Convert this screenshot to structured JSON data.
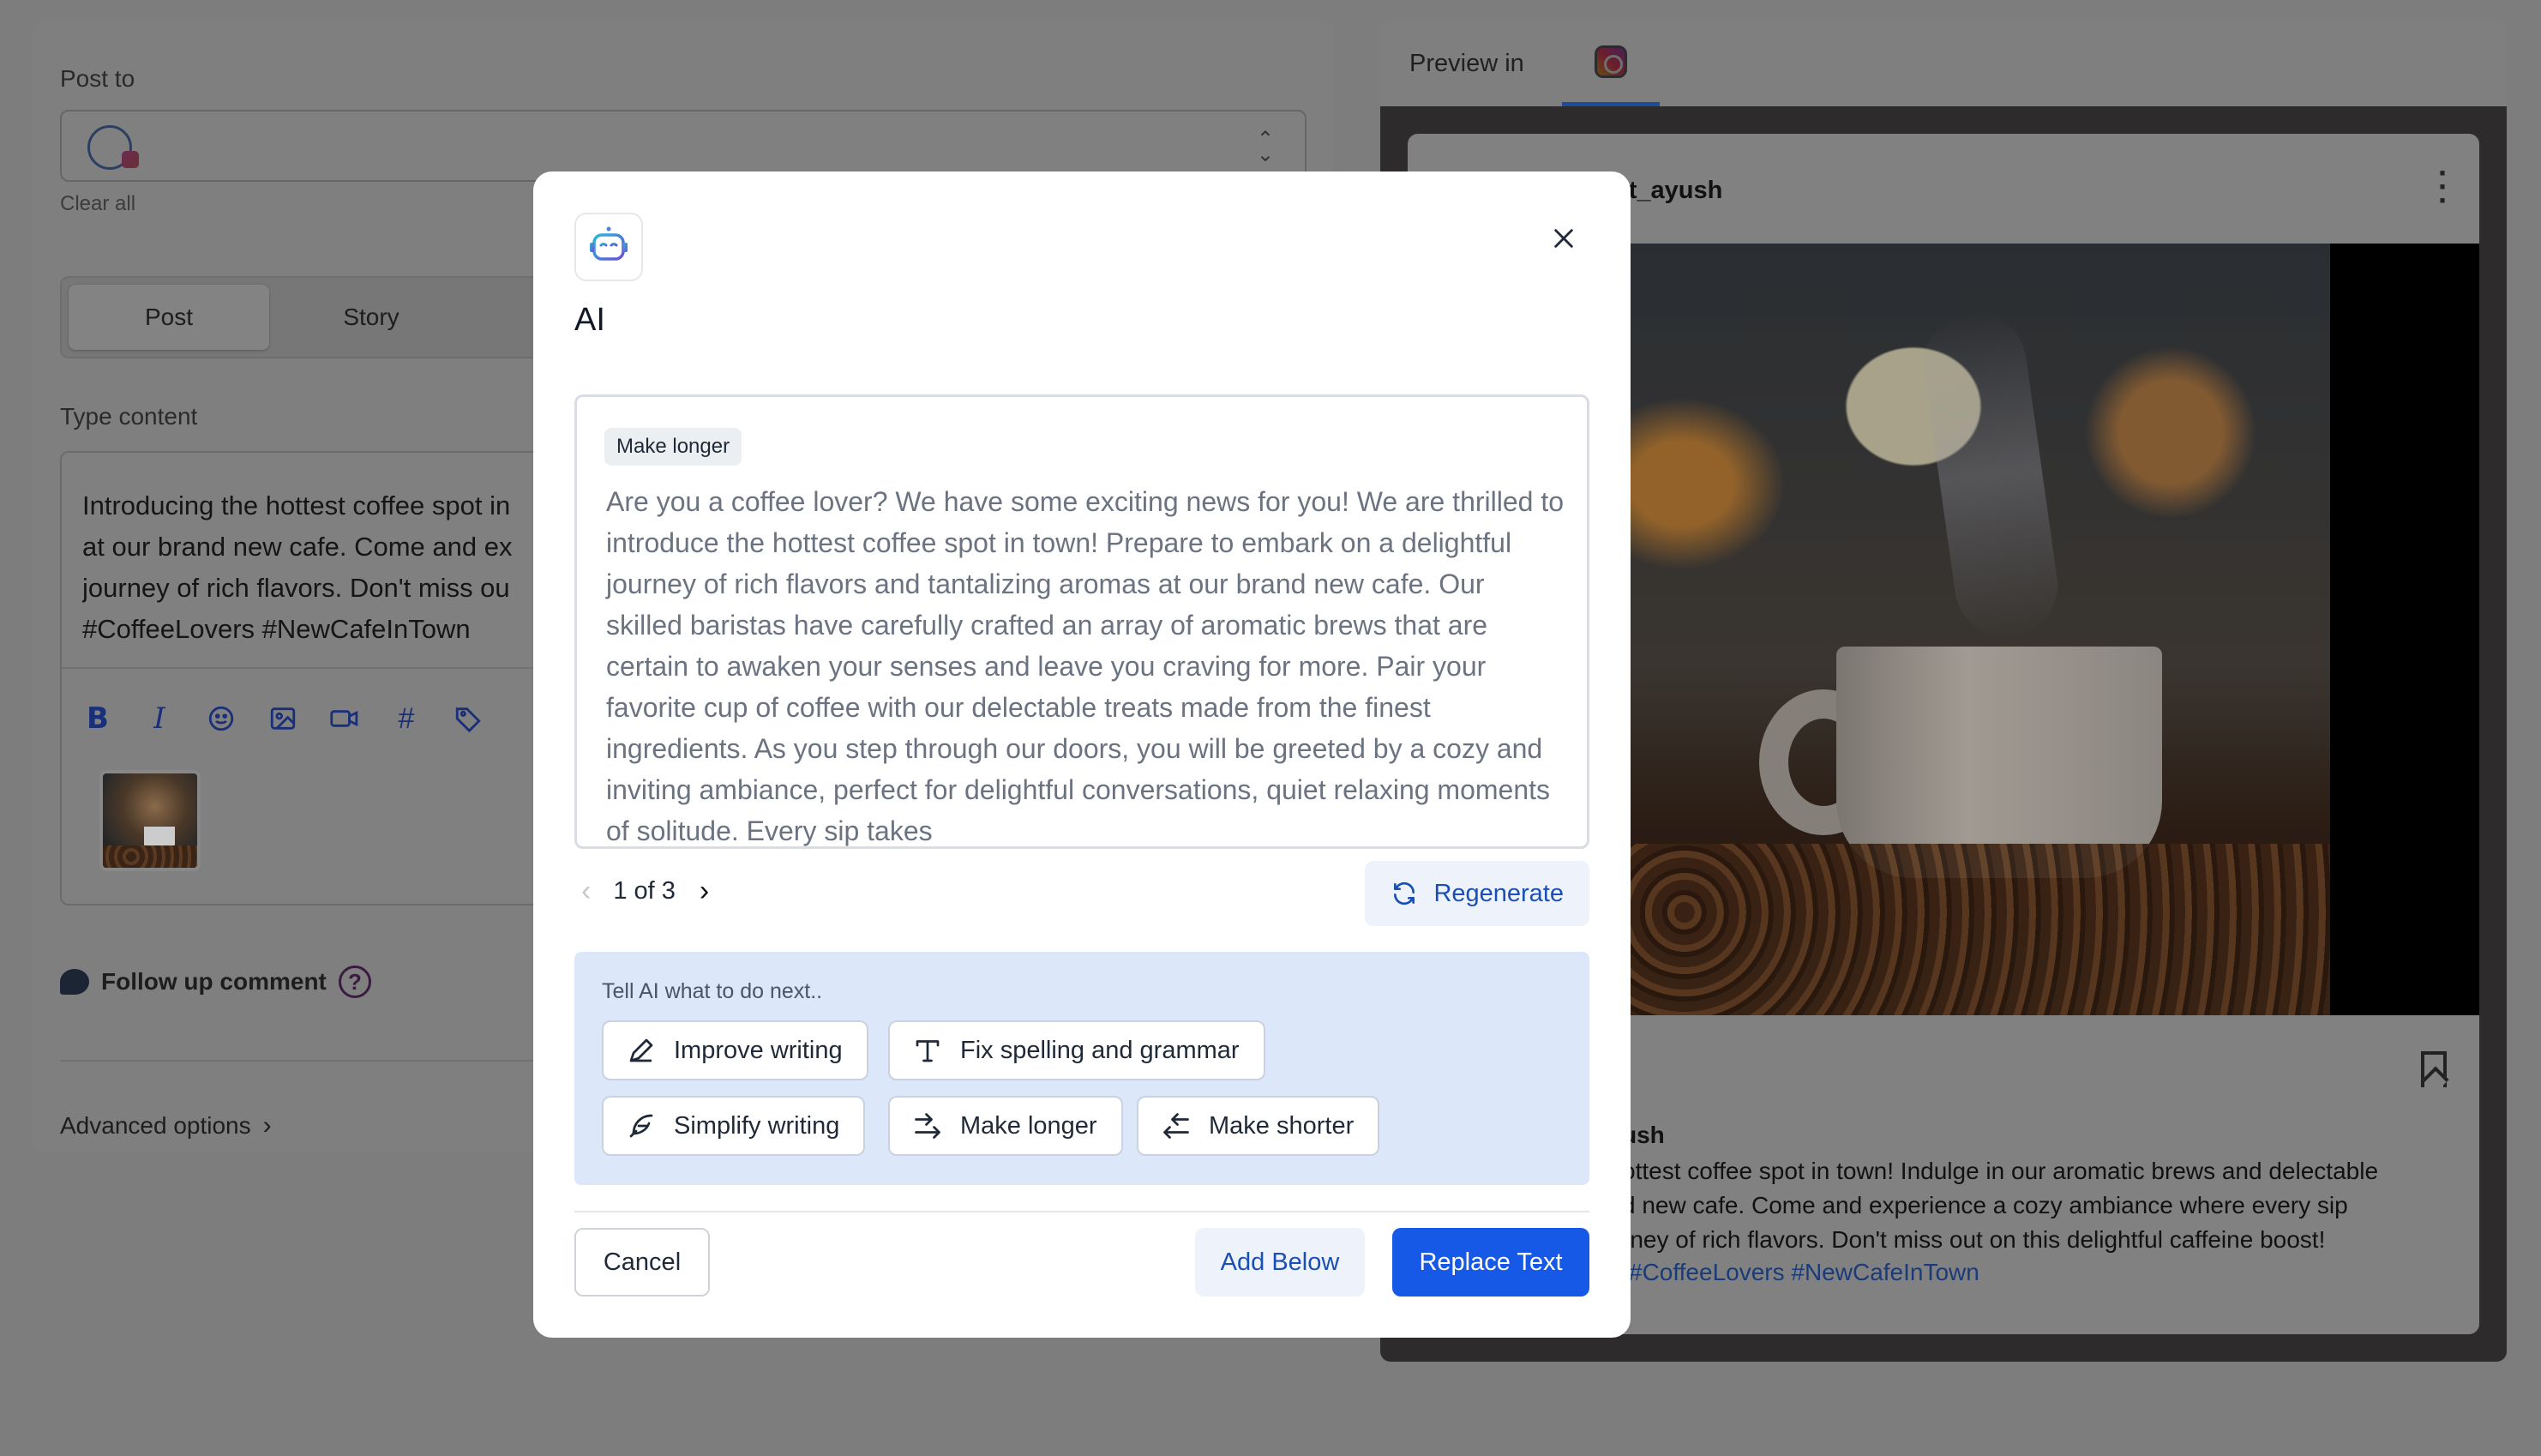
{
  "composer": {
    "post_to_label": "Post to",
    "clear_all": "Clear all",
    "tabs": [
      {
        "label": "Post",
        "active": true
      },
      {
        "label": "Story",
        "active": false
      }
    ],
    "type_content_label": "Type content",
    "content_text": "Introducing the hottest coffee spot in\nat our brand new cafe. Come and ex\njourney of rich flavors. Don't miss ou\n#CoffeeLovers #NewCafeInTown",
    "toolbar_icons": [
      "bold-icon",
      "italic-icon",
      "emoji-icon",
      "image-icon",
      "video-icon",
      "hashtag-icon",
      "tag-icon"
    ],
    "follow_up_comment": "Follow up comment",
    "advanced_options": "Advanced options"
  },
  "preview": {
    "label": "Preview in",
    "platform_icon": "instagram-icon",
    "username": "nt_ayush",
    "caption_user": "ush",
    "caption": "ottest coffee spot in town! Indulge in our aromatic brews and delectable\nd new cafe. Come and experience a cozy ambiance where every sip\nrney of rich flavors. Don't miss out on this delightful caffeine boost!",
    "hashtags": "#CoffeeLovers #NewCafeInTown"
  },
  "modal": {
    "title": "AI",
    "result_tag": "Make longer",
    "result_text": "Are you a coffee lover? We have some exciting news for you! We are thrilled to introduce the hottest coffee spot in town! Prepare to embark on a delightful journey of rich flavors and tantalizing aromas at our brand new cafe. Our skilled baristas have carefully crafted an array of aromatic brews that are certain to awaken your senses and leave you craving for more. Pair your favorite cup of coffee with our delectable treats made from the finest ingredients. As you step through our doors, you will be greeted by a cozy and inviting ambiance, perfect for delightful conversations, quiet relaxing moments of solitude. Every sip takes",
    "pager": "1 of 3",
    "regenerate": "Regenerate",
    "hint": "Tell AI what to do next..",
    "actions": [
      {
        "label": "Improve writing",
        "icon": "pen-icon"
      },
      {
        "label": "Fix spelling and grammar",
        "icon": "text-icon"
      },
      {
        "label": "Simplify writing",
        "icon": "feather-icon"
      },
      {
        "label": "Make longer",
        "icon": "expand-arrows-icon"
      },
      {
        "label": "Make shorter",
        "icon": "shrink-arrows-icon"
      }
    ],
    "cancel": "Cancel",
    "add_below": "Add Below",
    "replace_text": "Replace Text"
  },
  "colors": {
    "primary": "#1559e6",
    "primary_text": "#1a4fb5",
    "ai_panel": "#dce8fa",
    "overlay": "#7d7d7d"
  }
}
